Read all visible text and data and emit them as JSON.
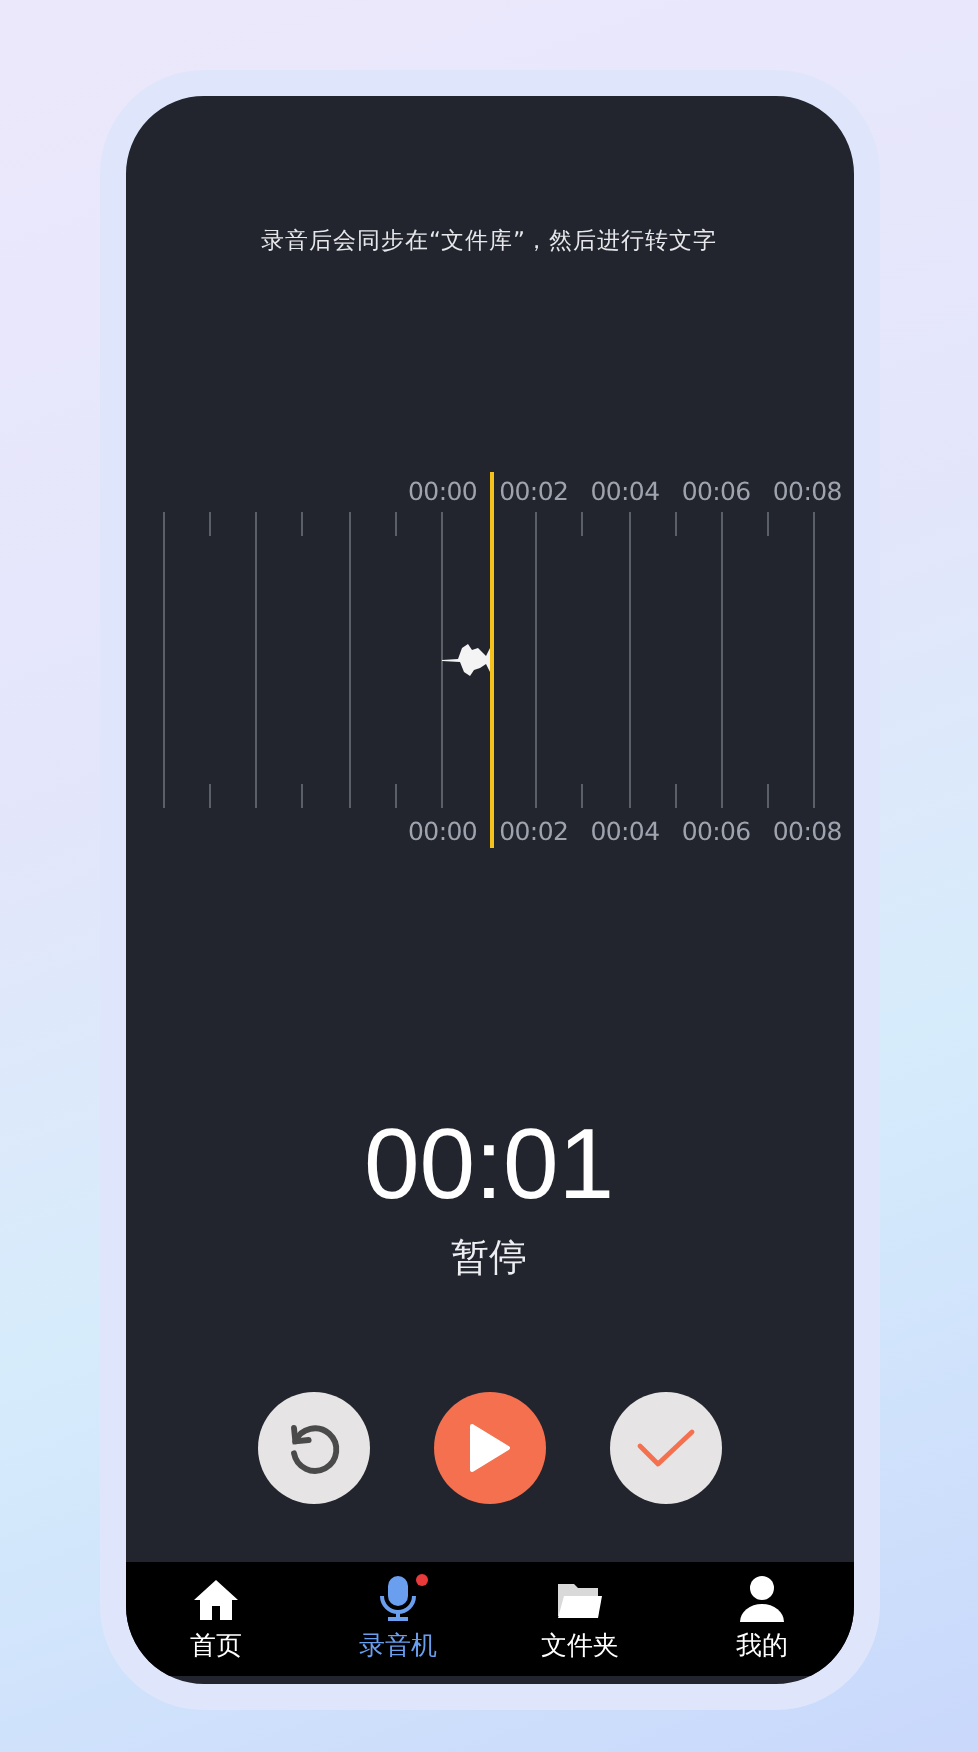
{
  "hint": "录音后会同步在“文件库”，然后进行转文字",
  "timeline": {
    "top_labels": [
      "00:00",
      "00:02",
      "00:04",
      "00:06",
      "00:08"
    ],
    "bottom_labels": [
      "00:00",
      "00:02",
      "00:04",
      "00:06",
      "00:08"
    ]
  },
  "timer": "00:01",
  "status": "暂停",
  "controls": [
    {
      "kind": "reset"
    },
    {
      "kind": "play"
    },
    {
      "kind": "done"
    }
  ],
  "nav": [
    {
      "label": "首页",
      "kind": "home",
      "selected": false,
      "dot": false
    },
    {
      "label": "录音机",
      "kind": "mic",
      "selected": true,
      "dot": true
    },
    {
      "label": "文件夹",
      "kind": "folder",
      "selected": false,
      "dot": false
    },
    {
      "label": "我的",
      "kind": "user",
      "selected": false,
      "dot": false
    }
  ]
}
